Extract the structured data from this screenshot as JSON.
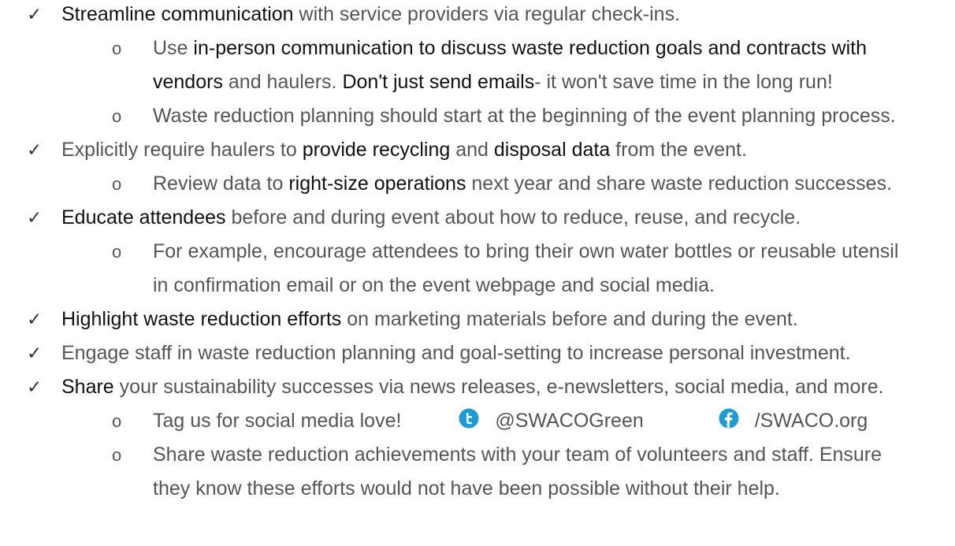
{
  "check_glyph": "✓",
  "sub_glyph": "o",
  "lines": {
    "l1_b": "Streamline communication",
    "l1_t": " with service providers via regular check-ins.",
    "l2_t1": "Use ",
    "l2_b": "in-person communication to discuss waste reduction goals and contracts with",
    "l3_b1": "vendors",
    "l3_t1": " and haulers. ",
    "l3_b2": "Don't just send emails",
    "l3_t2": "- it won't save time in the long run!",
    "l4_t": "Waste reduction planning should start at the beginning of the event planning process.",
    "l5_t1": "Explicitly require haulers to ",
    "l5_b1": "provide recycling",
    "l5_t2": " and ",
    "l5_b2": "disposal data",
    "l5_t3": " from the event.",
    "l6_t1": "Review data to ",
    "l6_b": "right-size operations",
    "l6_t2": " next year and share waste reduction successes.",
    "l7_b": "Educate attendees",
    "l7_t": " before and during event about how to reduce, reuse, and recycle.",
    "l8_t": "For example, encourage attendees to bring their own water bottles or reusable utensil",
    "l9_t": "in confirmation email or on the event webpage and social media.",
    "l10_b": "Highlight waste reduction efforts",
    "l10_t": " on marketing materials before and during the event.",
    "l11_t": "Engage staff in waste reduction planning and goal-setting to increase personal investment.",
    "l12_b": "Share",
    "l12_t": " your sustainability successes via news releases, e-newsletters, social media, and more.",
    "l13_t": "Tag us for social media love!",
    "l13_twitter": "@SWACOGreen",
    "l13_facebook": "/SWACO.org",
    "l14_t": "Share waste reduction achievements with your team of volunteers and staff. Ensure",
    "l15_t": "they know these efforts would not have been possible without their help."
  },
  "icons": {
    "twitter": "twitter-icon",
    "facebook": "facebook-icon"
  },
  "colors": {
    "text": "#555555",
    "bold_text": "#111111",
    "icon_blue": "#1e9bd7"
  }
}
